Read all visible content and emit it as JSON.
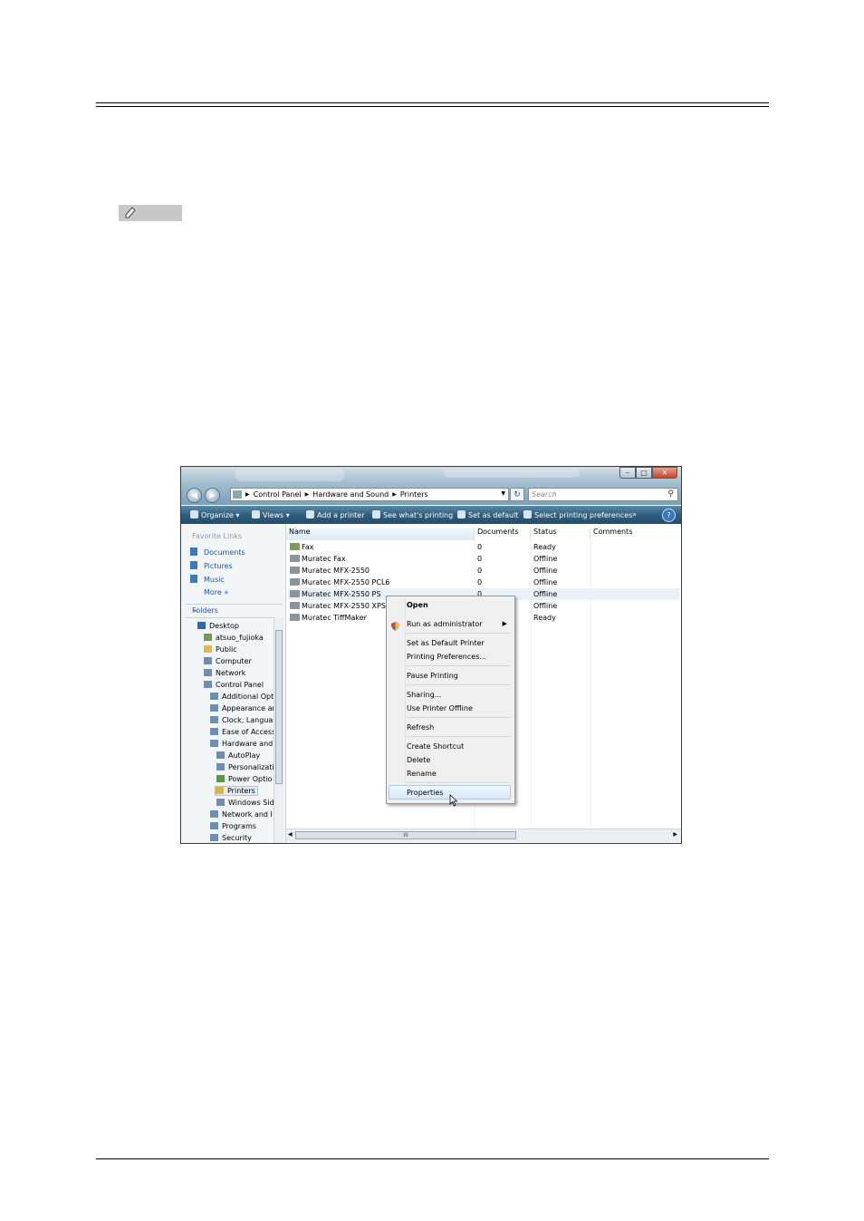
{
  "window": {
    "breadcrumb": [
      "Control Panel",
      "Hardware and Sound",
      "Printers"
    ],
    "search_placeholder": "Search",
    "toolbar": [
      "Organize",
      "Views",
      "Add a printer",
      "See what's printing",
      "Set as default",
      "Select printing preferences",
      "»"
    ],
    "favorite_links_title": "Favorite Links",
    "favorite_links": [
      "Documents",
      "Pictures",
      "Music",
      "More »"
    ],
    "folders_title": "Folders",
    "tree": [
      "Desktop",
      "atsuo_fujioka",
      "Public",
      "Computer",
      "Network",
      "Control Panel",
      "Additional Opt",
      "Appearance ar",
      "Clock, Langua",
      "Ease of Access",
      "Hardware and",
      "AutoPlay",
      "Personalizati",
      "Power Optio",
      "Printers",
      "Windows Sid",
      "Network and I",
      "Programs",
      "Security"
    ],
    "columns": [
      "Name",
      "Documents",
      "Status",
      "Comments"
    ],
    "printers": [
      {
        "name": "Fax",
        "docs": "0",
        "status": "Ready"
      },
      {
        "name": "Muratec Fax",
        "docs": "0",
        "status": "Offline"
      },
      {
        "name": "Muratec MFX-2550",
        "docs": "0",
        "status": "Offline"
      },
      {
        "name": "Muratec MFX-2550 PCL6",
        "docs": "0",
        "status": "Offline"
      },
      {
        "name": "Muratec MFX-2550 PS",
        "docs": "0",
        "status": "Offline"
      },
      {
        "name": "Muratec MFX-2550 XPS",
        "docs": "",
        "status": "Offline"
      },
      {
        "name": "Muratec TiffMaker",
        "docs": "",
        "status": "Ready"
      }
    ],
    "context_menu": [
      "Open",
      "Run as administrator",
      "Set as Default Printer",
      "Printing Preferences...",
      "Pause Printing",
      "Sharing...",
      "Use Printer Offline",
      "Refresh",
      "Create Shortcut",
      "Delete",
      "Rename",
      "Properties"
    ],
    "scroll_grip": "III"
  }
}
